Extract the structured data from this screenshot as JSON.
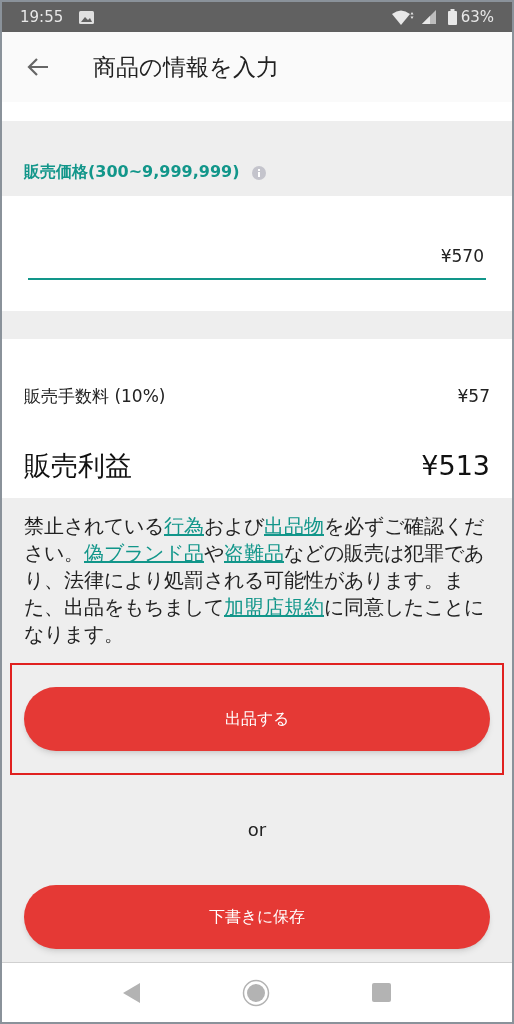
{
  "status_bar": {
    "time": "19:55",
    "battery": "63%"
  },
  "app_bar": {
    "title": "商品の情報を入力"
  },
  "price": {
    "label": "販売価格(300~9,999,999)",
    "value": "¥570"
  },
  "fee": {
    "label": "販売手数料 (10%)",
    "value": "¥57"
  },
  "profit": {
    "label": "販売利益",
    "value": "¥513"
  },
  "notice": [
    {
      "text": "禁止されている",
      "link": false
    },
    {
      "text": "行為",
      "link": true
    },
    {
      "text": "および",
      "link": false
    },
    {
      "text": "出品物",
      "link": true
    },
    {
      "text": "を必ずご確認ください。",
      "link": false
    },
    {
      "text": "偽ブランド品",
      "link": true
    },
    {
      "text": "や",
      "link": false
    },
    {
      "text": "盗難品",
      "link": true
    },
    {
      "text": "などの販売は犯罪であり、法律により処罰される可能性があります。また、出品をもちまして",
      "link": false
    },
    {
      "text": "加盟店規約",
      "link": true
    },
    {
      "text": "に同意したことになります。",
      "link": false
    }
  ],
  "buttons": [
    {
      "label": "出品する",
      "highlighted": true
    },
    {
      "label": "下書きに保存",
      "highlighted": false
    }
  ],
  "separator": "or"
}
